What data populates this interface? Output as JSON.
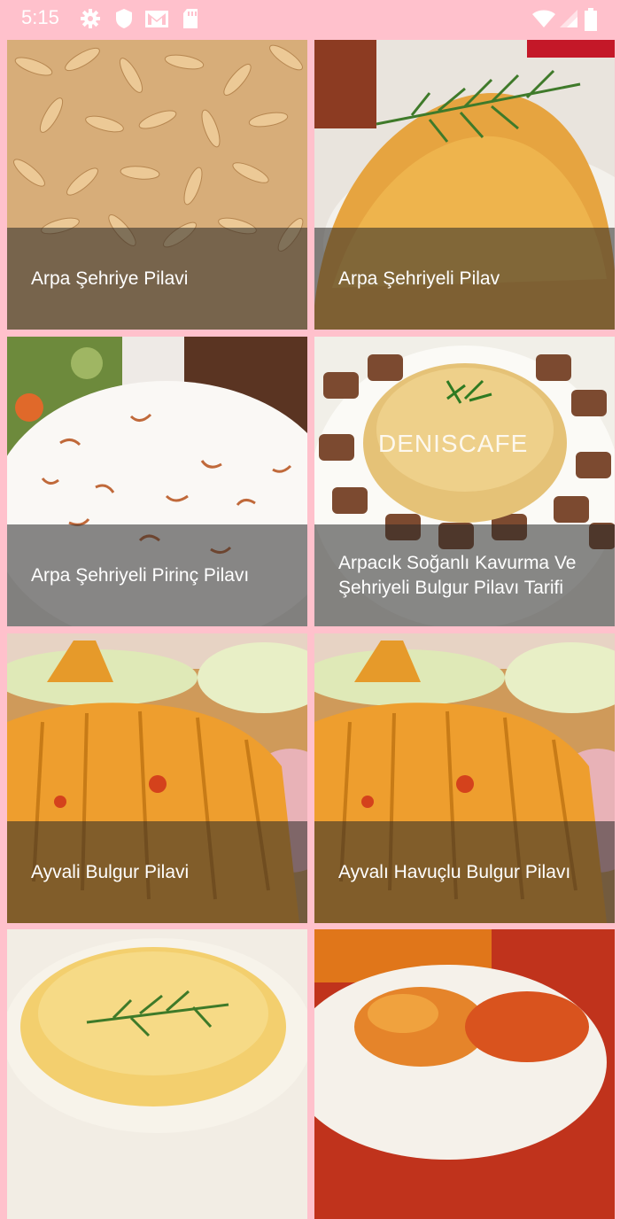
{
  "status_bar": {
    "time": "5:15",
    "icons": [
      "gear-icon",
      "shield-icon",
      "gmail-icon",
      "sd-card-icon",
      "wifi-icon",
      "signal-icon",
      "battery-icon"
    ]
  },
  "colors": {
    "background": "#ffc1cc",
    "caption_overlay": "rgba(40,40,40,0.55)"
  },
  "recipes": [
    {
      "title": "Arpa Şehriye Pilavi"
    },
    {
      "title": "Arpa Şehriyeli Pilav"
    },
    {
      "title": "Arpa Şehriyeli Pirinç Pilavı"
    },
    {
      "title": "Arpacık Soğanlı Kavurma Ve Şehriyeli Bulgur Pilavı Tarifi",
      "watermark": "DENISCAFE"
    },
    {
      "title": "Ayvali Bulgur Pilavi"
    },
    {
      "title": "Ayvalı Havuçlu Bulgur Pilavı"
    },
    {
      "title": ""
    },
    {
      "title": ""
    }
  ]
}
